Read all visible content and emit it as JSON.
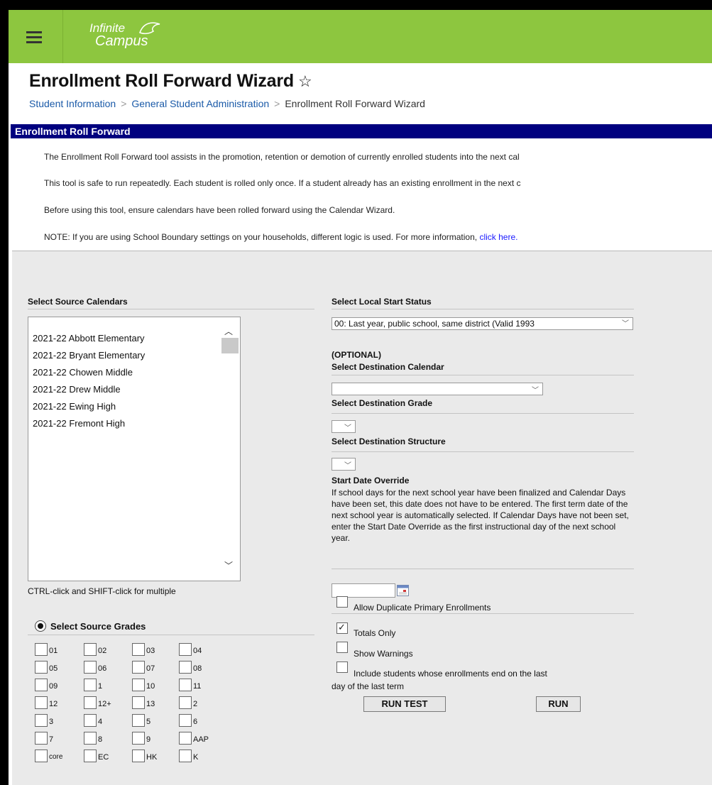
{
  "header": {
    "menu_icon": "hamburger-menu-icon",
    "logo_line1": "Infinite",
    "logo_line2": "Campus",
    "brand_color": "#8dc63f"
  },
  "page": {
    "title": "Enrollment Roll Forward Wizard",
    "favorite_icon": "star-outline-icon",
    "breadcrumb": [
      "Student Information",
      "General Student Administration",
      "Enrollment Roll Forward Wizard"
    ]
  },
  "section": {
    "title": "Enrollment Roll Forward",
    "bar_color": "#00007f",
    "descriptions": [
      "The Enrollment Roll Forward tool assists in the promotion, retention or demotion of currently enrolled students into the next cal",
      "This tool is safe to run repeatedly. Each student is rolled only once. If a student already has an existing enrollment in the next c",
      "Before using this tool, ensure calendars have been rolled forward using the Calendar Wizard."
    ],
    "note_prefix": "NOTE: If you are using School Boundary settings on your households, different logic is used. For more information,",
    "note_link": "click here."
  },
  "left": {
    "source_calendars_label": "Select Source Calendars",
    "calendars": [
      "2021-22 Abbott Elementary",
      "2021-22 Bryant Elementary",
      "2021-22 Chowen Middle",
      "2021-22 Drew Middle",
      "2021-22 Ewing High",
      "2021-22 Fremont High"
    ],
    "multi_hint": "CTRL-click and SHIFT-click for multiple",
    "grades_label": "Select Source Grades",
    "grades": [
      "01",
      "02",
      "03",
      "04",
      "05",
      "06",
      "07",
      "08",
      "09",
      "1",
      "10",
      "11",
      "12",
      "12+",
      "13",
      "2",
      "3",
      "4",
      "5",
      "6",
      "7",
      "8",
      "9",
      "AAP",
      "core",
      "EC",
      "HK",
      "K"
    ]
  },
  "right": {
    "start_status_label": "Select Local Start Status",
    "start_status_value": "00: Last year, public school, same district (Valid 1993",
    "optional_label": "(OPTIONAL)",
    "dest_calendar_label": "Select Destination Calendar",
    "dest_calendar_value": "",
    "dest_grade_label": "Select Destination Grade",
    "dest_structure_label": "Select Destination Structure",
    "start_override_label": "Start Date Override",
    "start_override_help": "If school days for the next school year have been finalized and Calendar Days have been set, this date does not have to be entered. The first term date of the next school year is automatically selected. If Calendar Days have not been set, enter the Start Date Override as the first instructional day of the next school year.",
    "start_override_value": "",
    "allow_duplicate_label": "Allow Duplicate Primary Enrollments",
    "totals_only_label": "Totals Only",
    "totals_only_checked": "true",
    "show_warnings_label": "Show Warnings",
    "include_students_line1": "Include students whose enrollments end on the last",
    "include_students_line2": "day of the last term",
    "run_test_label": "RUN TEST",
    "run_label": "RUN"
  }
}
